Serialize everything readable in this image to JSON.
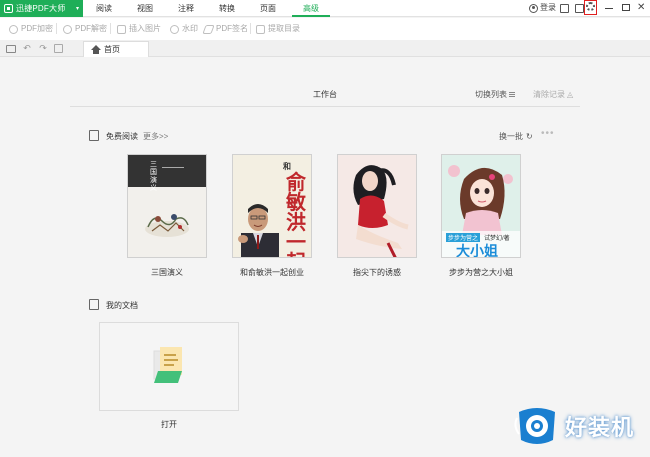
{
  "app": {
    "title": "迅捷PDF大师",
    "caret": "▾"
  },
  "menu": {
    "tabs": [
      {
        "label": "阅读",
        "active": false
      },
      {
        "label": "视图",
        "active": false
      },
      {
        "label": "注释",
        "active": false
      },
      {
        "label": "转换",
        "active": false
      },
      {
        "label": "页面",
        "active": false
      },
      {
        "label": "高级",
        "active": true
      }
    ]
  },
  "topright": {
    "login_label": "登录",
    "close_glyph": "✕"
  },
  "toolbar": {
    "items": [
      {
        "label": "PDF加密",
        "icon": "shield-icon"
      },
      {
        "label": "PDF解密",
        "icon": "shield-open-icon"
      },
      {
        "label": "插入图片",
        "icon": "image-icon"
      },
      {
        "label": "水印",
        "icon": "watermark-icon"
      },
      {
        "label": "PDF签名",
        "icon": "pen-icon"
      },
      {
        "label": "提取目录",
        "icon": "extract-icon"
      }
    ]
  },
  "quick_access": {
    "undo_glyph": "↶",
    "redo_glyph": "↷"
  },
  "doc_tab": {
    "label": "首页"
  },
  "workspace": {
    "title": "工作台",
    "switch_list": "切换列表",
    "clear_history": "清除记录",
    "clear_glyph": "◬"
  },
  "free_reading": {
    "title": "免费阅读",
    "more": "更多>>",
    "refresh": "换一批",
    "refresh_glyph": "↻",
    "dots": "•••",
    "books": [
      {
        "title": "三国演义",
        "cover_text": "三国演义"
      },
      {
        "title": "和俞敏洪一起创业",
        "cover_text": "俞敏洪一起创业",
        "cover_small": "和"
      },
      {
        "title": "指尖下的诱惑"
      },
      {
        "title": "步步为营之大小姐",
        "cover_tag": "步步为营之",
        "cover_author": "试梦幻/著",
        "cover_big": "大小姐"
      }
    ]
  },
  "my_docs": {
    "title": "我的文档",
    "open_label": "打开"
  },
  "watermark": {
    "text": "好装机"
  },
  "colors": {
    "accent": "#1fae58",
    "highlight": "#e02020"
  }
}
